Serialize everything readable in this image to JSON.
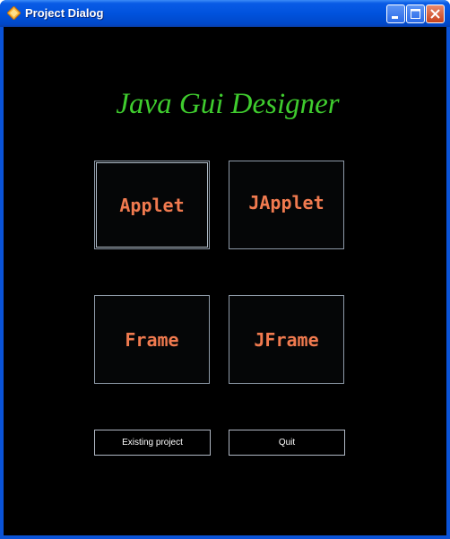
{
  "window": {
    "title": "Project Dialog"
  },
  "heading": "Java Gui Designer",
  "buttons": {
    "applet": "Applet",
    "japplet": "JApplet",
    "frame": "Frame",
    "jframe": "JFrame",
    "existing": "Existing project",
    "quit": "Quit"
  },
  "colors": {
    "heading": "#3fcc2e",
    "button_text": "#f07a4f",
    "background": "#000000",
    "titlebar": "#0052dd"
  }
}
